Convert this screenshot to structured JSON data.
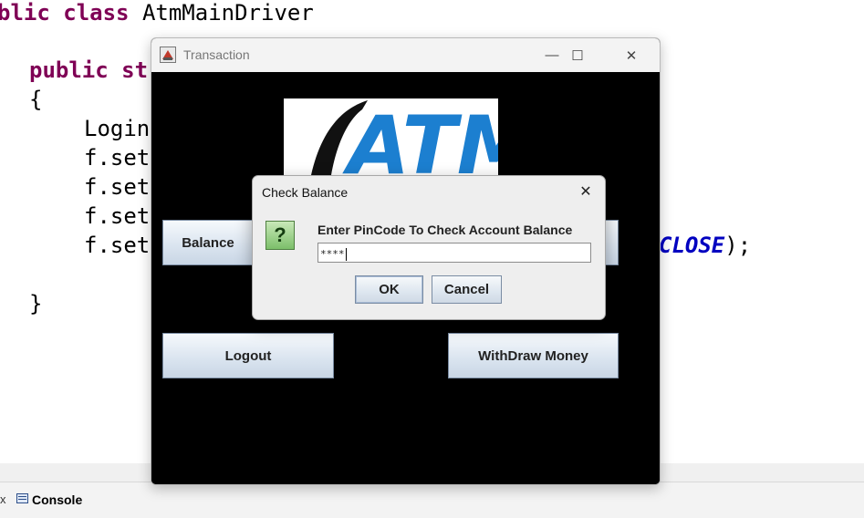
{
  "editor": {
    "line1_kw": "blic class",
    "line1_name": " AtmMainDriver",
    "line2_kw": "public",
    "line2_rest": " st",
    "line3": "{",
    "line4": "Login",
    "line5": "f.set",
    "line6": "f.set",
    "line7": "f.set",
    "line8": "f.set",
    "line8_const": "CLOSE",
    "line8_end": ");",
    "line9": "}"
  },
  "console": {
    "close_glyph": "x",
    "label": "Console"
  },
  "window": {
    "title": "Transaction",
    "minimize_glyph": "—",
    "maximize_glyph": "☐",
    "close_glyph": "✕",
    "logo_text": "ATM"
  },
  "buttons": {
    "balance": "Balance",
    "logout": "Logout",
    "withdraw": "WithDraw Money"
  },
  "dialog": {
    "title": "Check Balance",
    "close_glyph": "✕",
    "icon_glyph": "?",
    "message": "Enter PinCode To Check Account Balance",
    "input_value": "****",
    "ok_label": "OK",
    "cancel_label": "Cancel"
  },
  "colors": {
    "keyword": "#7f0055",
    "constant": "#0000c0",
    "window_body": "#000000",
    "logo_blue": "#1c7fd0"
  }
}
